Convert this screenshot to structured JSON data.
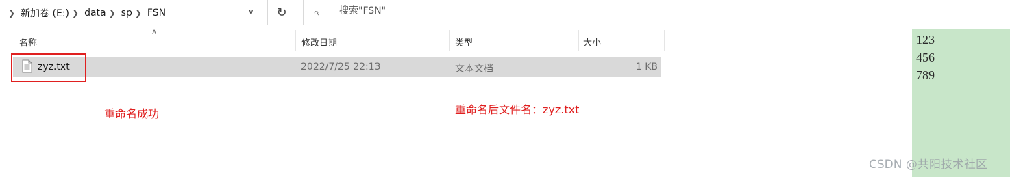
{
  "address_bar": {
    "breadcrumbs": [
      "新加卷 (E:)",
      "data",
      "sp",
      "FSN"
    ]
  },
  "search": {
    "placeholder": "搜索\"FSN\""
  },
  "columns": {
    "name": "名称",
    "modified": "修改日期",
    "type": "类型",
    "size": "大小"
  },
  "files": [
    {
      "name": "zyz.txt",
      "modified": "2022/7/25 22:13",
      "type": "文本文档",
      "size": "1 KB"
    }
  ],
  "annotations": {
    "rename_success": "重命名成功",
    "renamed_filename": "重命名后文件名：zyz.txt"
  },
  "preview": {
    "lines": [
      "123",
      "456",
      "789"
    ]
  },
  "watermark": "CSDN @共阳技术社区",
  "colors": {
    "annotation_red": "#e02020",
    "preview_bg": "#c8e6c9",
    "row_selected": "#d9d9d9"
  }
}
